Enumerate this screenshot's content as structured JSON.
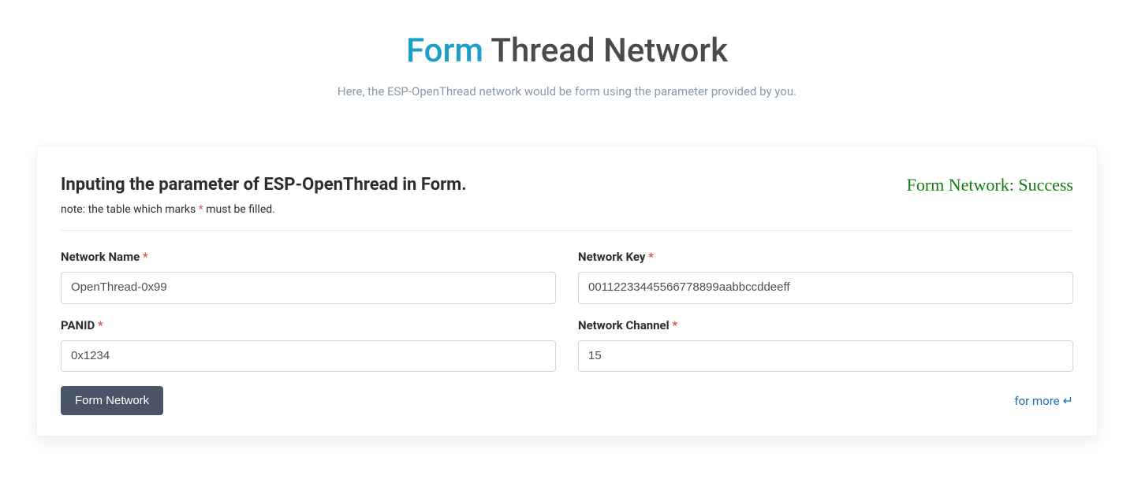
{
  "header": {
    "title_highlight": "Form",
    "title_rest": " Thread Network",
    "subtitle": "Here, the ESP-OpenThread network would be form using the parameter provided by you."
  },
  "card": {
    "title": "Inputing the parameter of ESP-OpenThread in Form.",
    "status": "Form Network: Success",
    "note_prefix": "note: the table which marks ",
    "note_mark": "*",
    "note_suffix": " must be filled."
  },
  "fields": {
    "network_name": {
      "label": "Network Name",
      "value": "OpenThread-0x99"
    },
    "network_key": {
      "label": "Network Key",
      "value": "00112233445566778899aabbccddeeff"
    },
    "panid": {
      "label": "PANID",
      "value": "0x1234"
    },
    "network_channel": {
      "label": "Network Channel",
      "value": "15"
    }
  },
  "required_mark": "*",
  "actions": {
    "submit_label": "Form Network",
    "more_label": "for more "
  }
}
